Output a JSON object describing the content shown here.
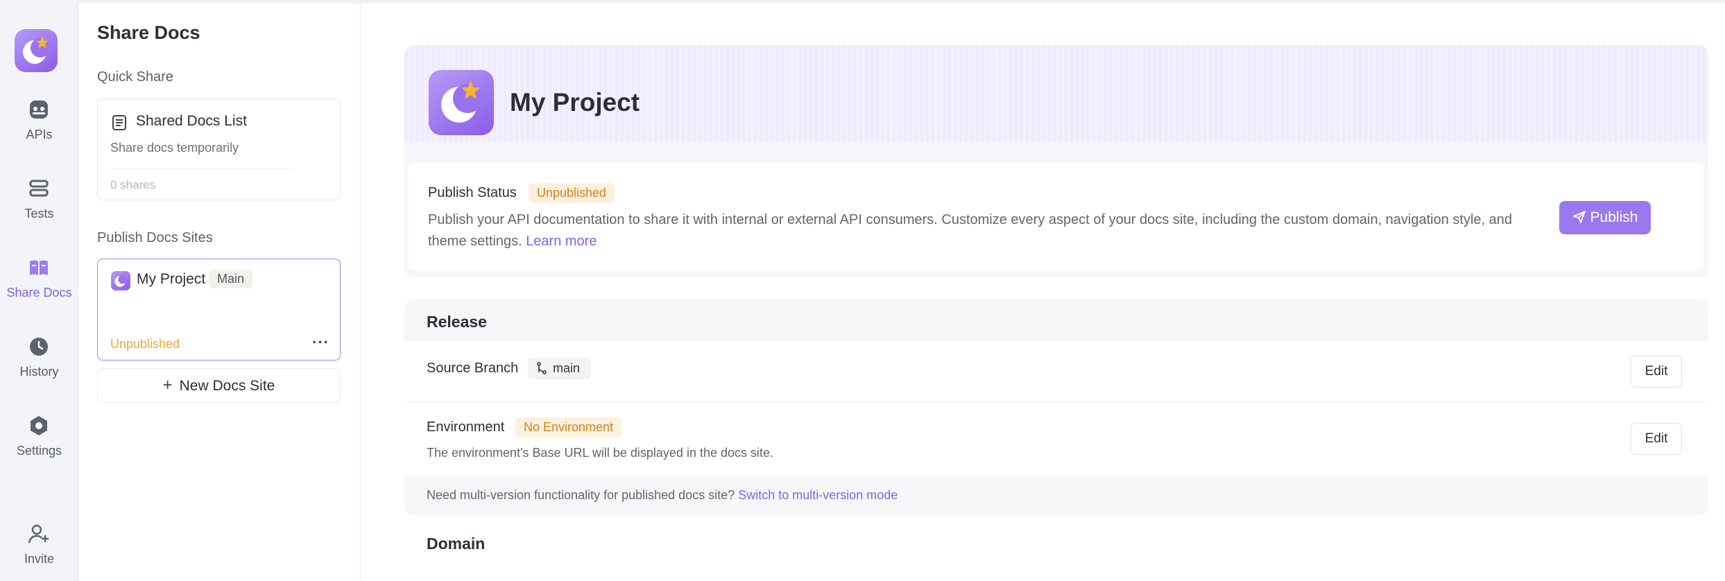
{
  "rail": {
    "items": [
      {
        "label": "APIs",
        "icon": "api-icon"
      },
      {
        "label": "Tests",
        "icon": "tests-icon"
      },
      {
        "label": "Share Docs",
        "icon": "book-icon"
      },
      {
        "label": "History",
        "icon": "clock-icon"
      },
      {
        "label": "Settings",
        "icon": "gear-icon"
      },
      {
        "label": "Invite",
        "icon": "user-plus-icon"
      }
    ],
    "active": "Share Docs",
    "accent": "#8560e8"
  },
  "sidebar": {
    "title": "Share Docs",
    "quick_share": {
      "label": "Quick Share",
      "card_title": "Shared Docs List",
      "card_sub": "Share docs temporarily",
      "card_count": "0 shares"
    },
    "publish_sites": {
      "label": "Publish Docs Sites",
      "project_name": "My Project",
      "branch": "Main",
      "status": "Unpublished",
      "more": "···"
    },
    "new_site": "New Docs Site"
  },
  "main": {
    "project_title": "My Project",
    "publish": {
      "label": "Publish Status",
      "badge": "Unpublished",
      "description": "Publish your API documentation to share it with internal or external API consumers. Customize every aspect of your docs site, including the custom domain, navigation style, and theme settings.",
      "learn_more": "Learn more",
      "button": "Publish"
    },
    "release": {
      "title": "Release",
      "source_branch_label": "Source Branch",
      "source_branch_value": "main",
      "environment_label": "Environment",
      "environment_value": "No Environment",
      "environment_desc": "The environment's Base URL will be displayed in the docs site.",
      "edit": "Edit",
      "multi_note": "Need multi-version functionality for published docs site?",
      "multi_link": "Switch to multi-version mode"
    },
    "domain_title": "Domain"
  }
}
